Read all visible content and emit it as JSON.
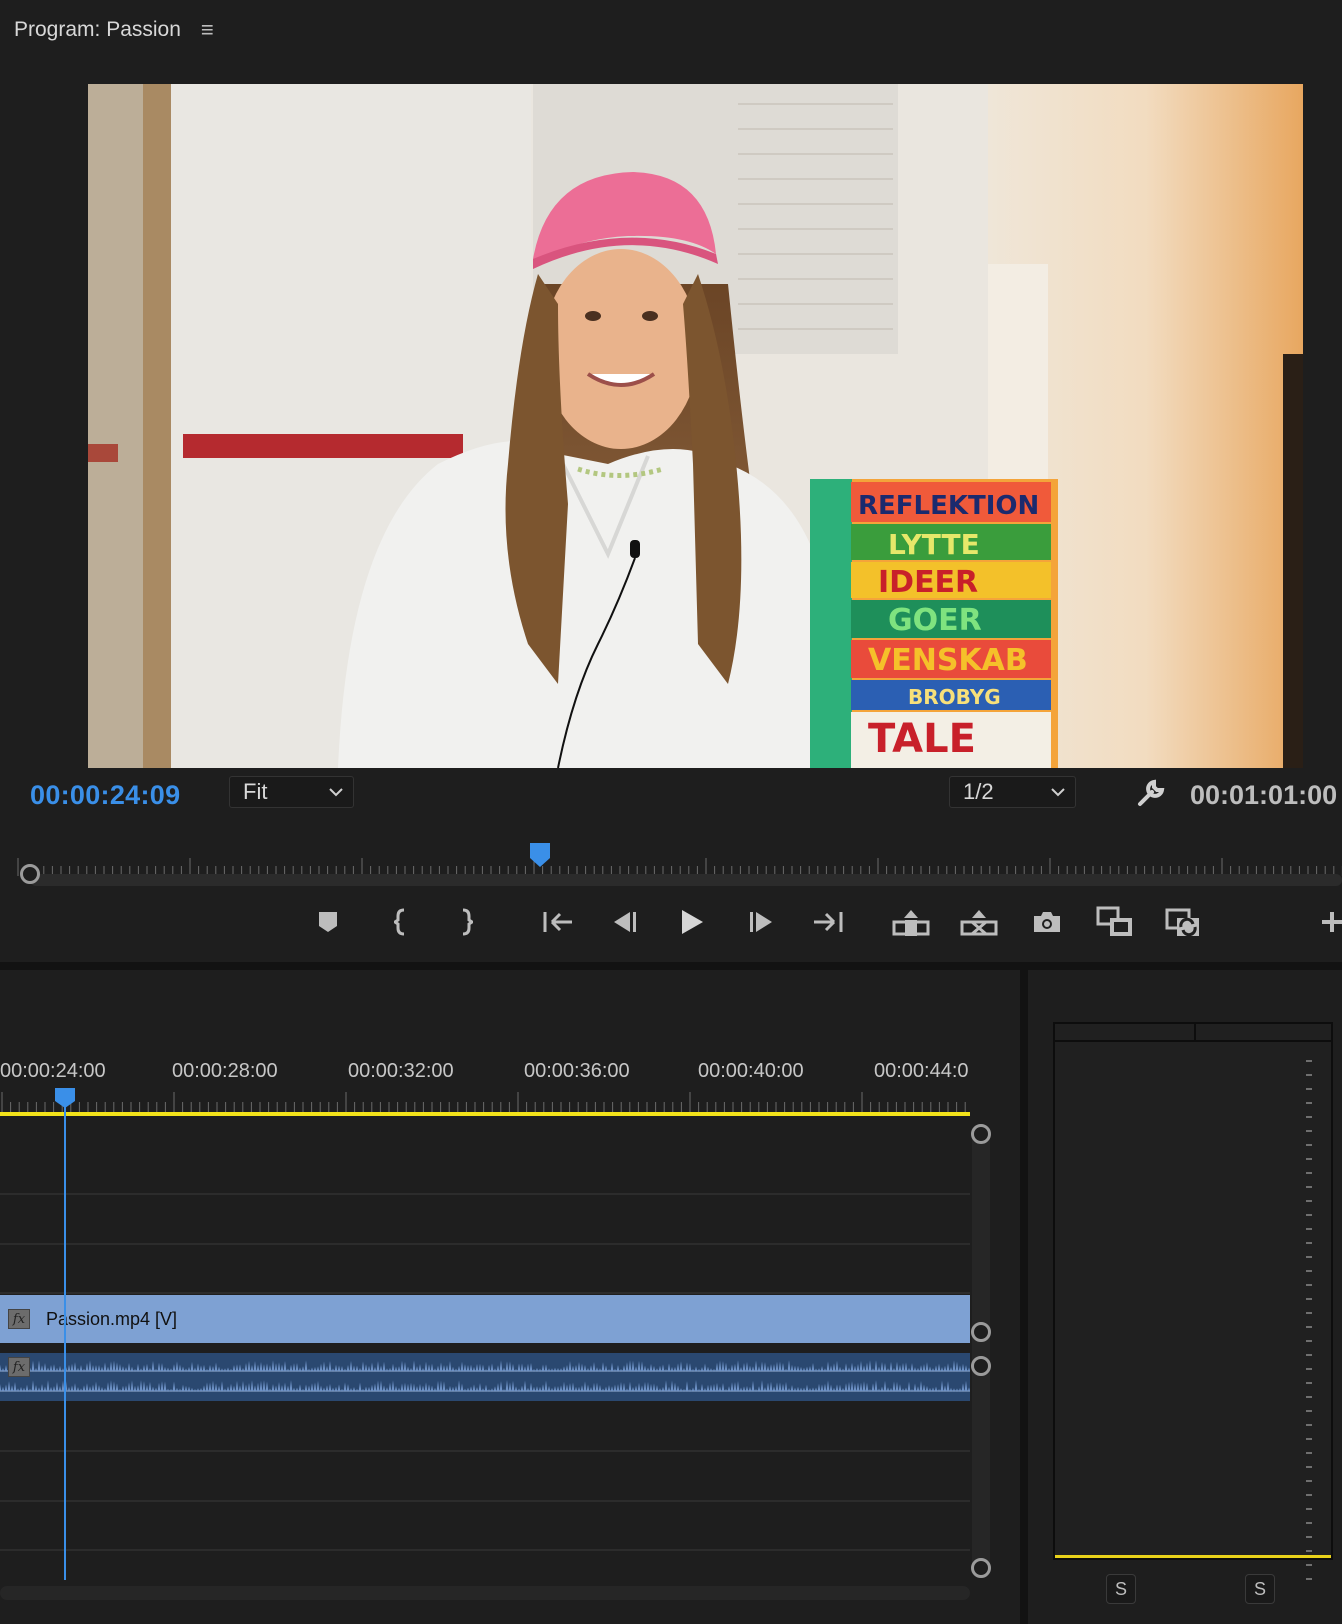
{
  "program_monitor": {
    "title": "Program: Passion",
    "menu_icon": "hamburger-icon",
    "current_timecode": "00:00:24:09",
    "zoom_select": {
      "value": "Fit"
    },
    "resolution_select": {
      "value": "1/2"
    },
    "duration_timecode": "00:01:01:00",
    "playhead_position": 0.395,
    "poster_text": [
      "REFLEKTION",
      "LYTTE",
      "IDEER",
      "GOER",
      "VENSKAB",
      "BROBYG",
      "TALE"
    ],
    "transport_buttons": [
      {
        "name": "add-marker",
        "icon": "marker-icon"
      },
      {
        "name": "mark-in",
        "icon": "mark-in-icon"
      },
      {
        "name": "mark-out",
        "icon": "mark-out-icon"
      },
      {
        "name": "go-to-in",
        "icon": "go-to-in-icon"
      },
      {
        "name": "step-back",
        "icon": "step-back-icon"
      },
      {
        "name": "play",
        "icon": "play-icon"
      },
      {
        "name": "step-forward",
        "icon": "step-forward-icon"
      },
      {
        "name": "go-to-out",
        "icon": "go-to-out-icon"
      },
      {
        "name": "lift",
        "icon": "lift-icon"
      },
      {
        "name": "extract",
        "icon": "extract-icon"
      },
      {
        "name": "export-frame",
        "icon": "camera-icon"
      },
      {
        "name": "comparison-view",
        "icon": "comparison-icon"
      },
      {
        "name": "toggle-proxies",
        "icon": "proxy-icon"
      },
      {
        "name": "button-editor",
        "icon": "plus-icon"
      }
    ]
  },
  "timeline": {
    "ruler_labels": [
      "00:00:24:00",
      "00:00:28:00",
      "00:00:32:00",
      "00:00:36:00",
      "00:00:40:00",
      "00:00:44:0"
    ],
    "video_clip": {
      "name": "Passion.mp4 [V]",
      "fx_label": "fx"
    },
    "audio_clip": {
      "fx_label": "fx"
    },
    "colors": {
      "playhead": "#3a8fe8",
      "work_area": "#f2e21a",
      "video_clip": "#7ea1d3",
      "audio_clip": "#2a4870"
    }
  },
  "audio_meters": {
    "solo_buttons": [
      "S",
      "S"
    ]
  }
}
